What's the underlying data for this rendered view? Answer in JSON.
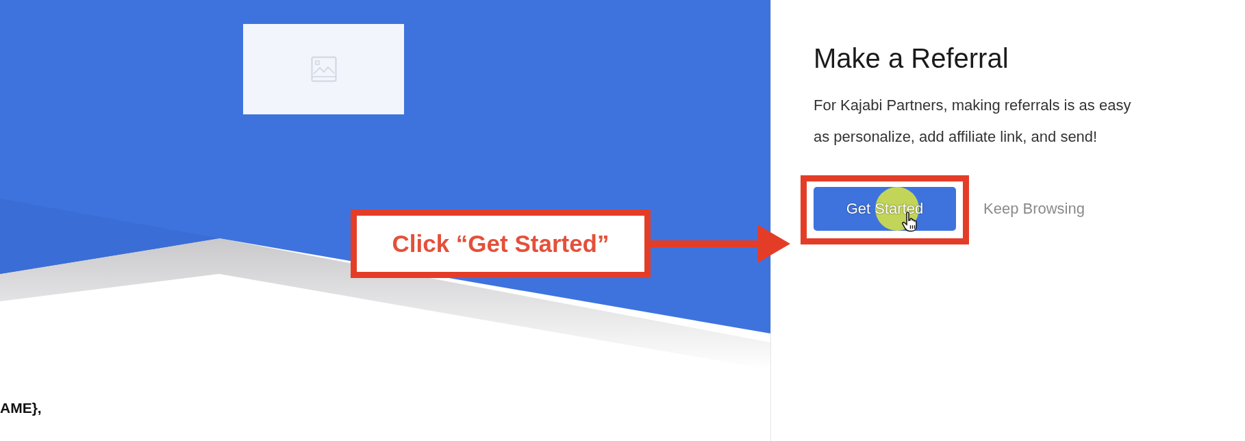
{
  "email_preview": {
    "greeting": "AME},"
  },
  "referral_panel": {
    "title": "Make a Referral",
    "description": "For Kajabi Partners, making referrals is as easy as personalize, add affiliate link, and send!",
    "buttons": [
      {
        "label": "Get Started",
        "kind": "primary"
      },
      {
        "label": "Keep Browsing",
        "kind": "link"
      }
    ]
  },
  "annotation": {
    "callout": "Click “Get Started”"
  }
}
